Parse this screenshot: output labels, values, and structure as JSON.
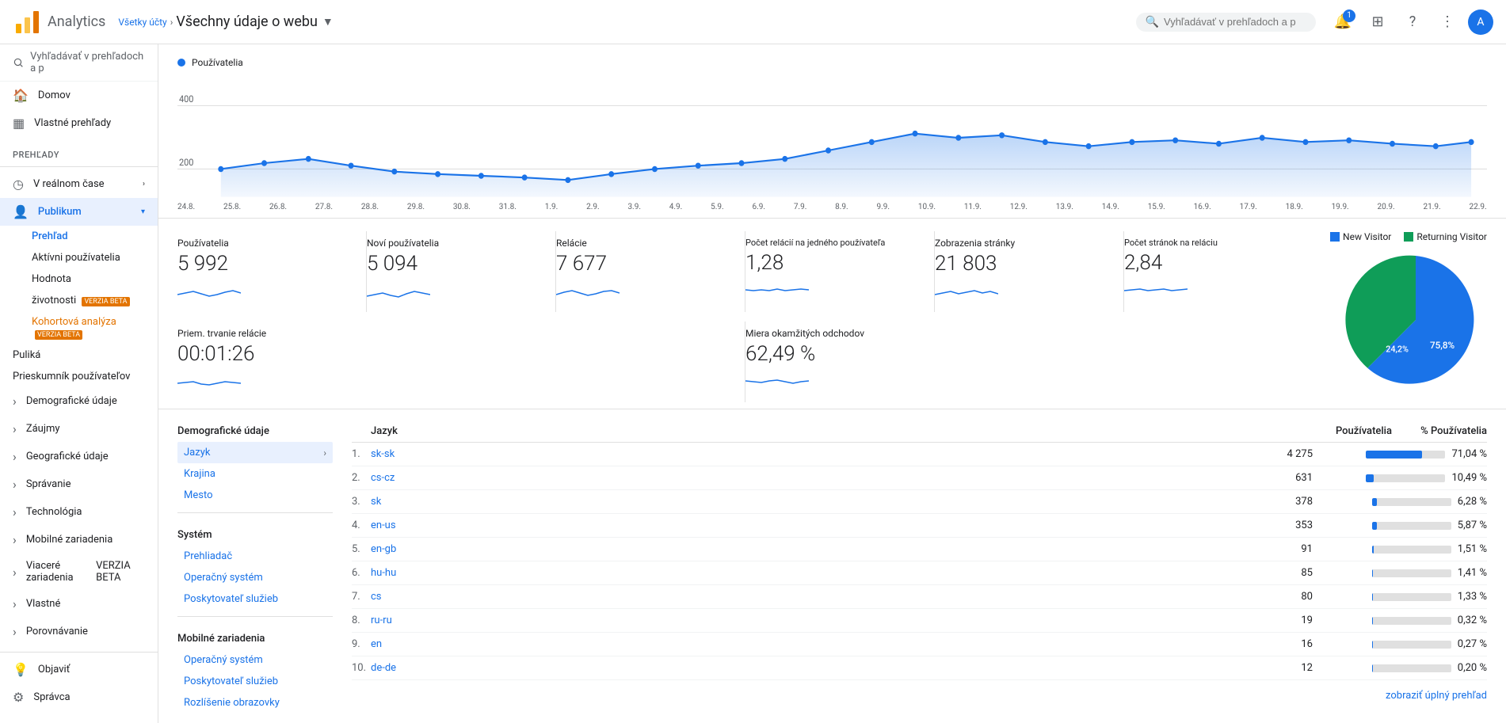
{
  "header": {
    "app_title": "Analytics",
    "breadcrumb_link": "Všetky účty",
    "breadcrumb_separator": ">",
    "property_name": "Všechny údaje o webu",
    "search_placeholder": "Vyhľadávať v prehľadoch a p",
    "notification_count": "1"
  },
  "sidebar": {
    "search_placeholder": "Vyhľadávať v prehľadoch a p",
    "nav_items": [
      {
        "id": "domov",
        "label": "Domov",
        "icon": "home"
      },
      {
        "id": "vlastne-prehady",
        "label": "Vlastné prehľady",
        "icon": "grid"
      }
    ],
    "section_prehady": "PREHĽADY",
    "realtime": {
      "label": "V reálnom čase",
      "icon": "clock"
    },
    "publikum": {
      "label": "Publikum",
      "active": true,
      "sub_items": [
        {
          "id": "prehlad",
          "label": "Prehľad",
          "active": true
        },
        {
          "id": "aktivni",
          "label": "Aktívni používatelia"
        },
        {
          "id": "hodnota",
          "label": "Hodnota"
        },
        {
          "id": "zivotnosti",
          "label": "životnosti",
          "badge": "VERZIA BETA"
        },
        {
          "id": "kohortova",
          "label": "Kohortová analýza",
          "badge": "VERZIA BETA",
          "orange": true
        }
      ]
    },
    "other_items": [
      {
        "id": "publika",
        "label": "Puliká"
      },
      {
        "id": "prieskumnik",
        "label": "Prieskumník používateľov"
      },
      {
        "id": "demograficke",
        "label": "Demografické údaje",
        "hasArrow": true
      },
      {
        "id": "zaujmy",
        "label": "Záujmy",
        "hasArrow": true
      },
      {
        "id": "geograficke",
        "label": "Geografické údaje",
        "hasArrow": true
      },
      {
        "id": "spravanie",
        "label": "Správanie",
        "hasArrow": true
      },
      {
        "id": "technologia",
        "label": "Technológia",
        "hasArrow": true
      },
      {
        "id": "mobilne",
        "label": "Mobilné zariadenia",
        "hasArrow": true
      },
      {
        "id": "viacere",
        "label": "Viaceré zariadenia",
        "badge": "VERZIA BETA",
        "hasArrow": true
      },
      {
        "id": "vlastne",
        "label": "Vlastné",
        "hasArrow": true
      },
      {
        "id": "porovnavanie",
        "label": "Porovnávanie",
        "hasArrow": true
      }
    ],
    "bottom_items": [
      {
        "id": "objavit",
        "label": "Objaviť",
        "icon": "lightbulb"
      },
      {
        "id": "spravca",
        "label": "Správca",
        "icon": "settings"
      }
    ]
  },
  "chart": {
    "legend_label": "Používatelia",
    "y_label_400": "400",
    "y_label_200": "200",
    "x_labels": [
      "24.8.",
      "25.8.",
      "26.8.",
      "27.8.",
      "28.8.",
      "29.8.",
      "30.8.",
      "31.8.",
      "1.9.",
      "2.9.",
      "3.9.",
      "4.9.",
      "5.9.",
      "6.9.",
      "7.9.",
      "8.9.",
      "9.9.",
      "10.9.",
      "11.9.",
      "12.9.",
      "13.9.",
      "14.9.",
      "15.9.",
      "16.9.",
      "17.9.",
      "18.9.",
      "19.9.",
      "20.9.",
      "21.9.",
      "22.9."
    ]
  },
  "metrics": [
    {
      "id": "pouzivatelia",
      "label": "Používatelia",
      "value": "5 992"
    },
    {
      "id": "novi",
      "label": "Noví používatelia",
      "value": "5 094"
    },
    {
      "id": "relacie",
      "label": "Relácie",
      "value": "7 677"
    },
    {
      "id": "pocet-relacii",
      "label": "Počet relácií na jedného používateľa",
      "value": "1,28"
    },
    {
      "id": "zobrazenia",
      "label": "Zobrazenia stránky",
      "value": "21 803"
    },
    {
      "id": "stranky-relaciu",
      "label": "Počet stránok na reláciu",
      "value": "2,84"
    },
    {
      "id": "trvanie",
      "label": "Priem. trvanie relácie",
      "value": "00:01:26"
    },
    {
      "id": "miera",
      "label": "Miera okamžitých odchodov",
      "value": "62,49 %"
    }
  ],
  "pie_chart": {
    "legend_new": "New Visitor",
    "legend_returning": "Returning Visitor",
    "new_pct": "24,2%",
    "returning_pct": "75,8%",
    "new_color": "#0f9d58",
    "returning_color": "#1a73e8"
  },
  "left_nav": {
    "section_demo": "Demografické údaje",
    "jazyk_label": "Jazyk",
    "krajina_label": "Krajina",
    "mesto_label": "Mesto",
    "section_system": "Systém",
    "prehlad_label": "Prehliadač",
    "op_sys_label": "Operačný systém",
    "poskytovatel_label": "Poskytovateľ služieb",
    "section_mobile": "Mobilné zariadenia",
    "op_sys_mobile": "Operačný systém",
    "poskytovatel_mobile": "Poskytovateľ služieb",
    "rozlisenie": "Rozlíšenie obrazovky"
  },
  "table": {
    "col_jazyk": "Jazyk",
    "col_pouzivatelia": "Používatelia",
    "col_pct": "% Používatelia",
    "rows": [
      {
        "rank": "1.",
        "lang": "sk-sk",
        "users": "4 275",
        "pct": "71,04 %",
        "bar_pct": 71
      },
      {
        "rank": "2.",
        "lang": "cs-cz",
        "users": "631",
        "pct": "10,49 %",
        "bar_pct": 10
      },
      {
        "rank": "3.",
        "lang": "sk",
        "users": "378",
        "pct": "6,28 %",
        "bar_pct": 6
      },
      {
        "rank": "4.",
        "lang": "en-us",
        "users": "353",
        "pct": "5,87 %",
        "bar_pct": 6
      },
      {
        "rank": "5.",
        "lang": "en-gb",
        "users": "91",
        "pct": "1,51 %",
        "bar_pct": 2
      },
      {
        "rank": "6.",
        "lang": "hu-hu",
        "users": "85",
        "pct": "1,41 %",
        "bar_pct": 1
      },
      {
        "rank": "7.",
        "lang": "cs",
        "users": "80",
        "pct": "1,33 %",
        "bar_pct": 1
      },
      {
        "rank": "8.",
        "lang": "ru-ru",
        "users": "19",
        "pct": "0,32 %",
        "bar_pct": 0
      },
      {
        "rank": "9.",
        "lang": "en",
        "users": "16",
        "pct": "0,27 %",
        "bar_pct": 0
      },
      {
        "rank": "10.",
        "lang": "de-de",
        "users": "12",
        "pct": "0,20 %",
        "bar_pct": 0
      }
    ],
    "full_report": "zobraziť úplný prehľad"
  }
}
